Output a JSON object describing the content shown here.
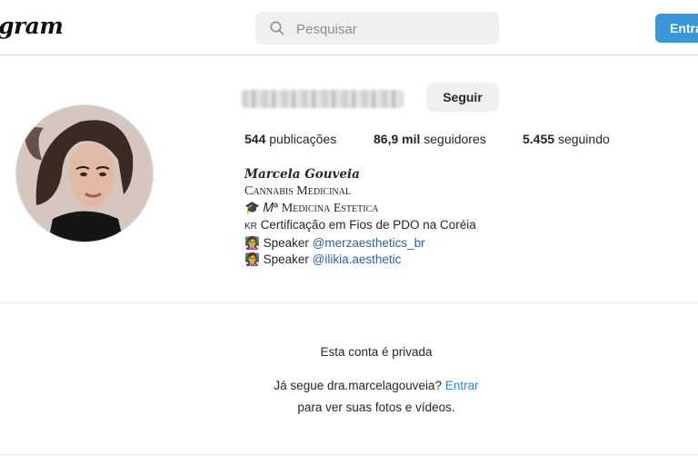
{
  "topbar": {
    "logo_text": "gram",
    "search_placeholder": "Pesquisar",
    "login_label": "Entrar"
  },
  "profile": {
    "follow_label": "Seguir",
    "stats": {
      "posts_count": "544",
      "posts_label": "publicações",
      "followers_count": "86,9 mil",
      "followers_label": "seguidores",
      "following_count": "5.455",
      "following_label": "seguindo"
    },
    "bio": {
      "name": "Marcela Gouveia",
      "line1_icon": "",
      "line1_text": "Cannabis Medicinal",
      "line2_icon": "🎓",
      "line2_prefix": "𝑀ª",
      "line2_text": "Medicina Estetica",
      "line3_prefix": "KR",
      "line3_text": "Certificação em Fios de PDO na Coréia",
      "line4_icon": "👩‍🏫",
      "line4_text": "Speaker",
      "line4_link": "@merzaesthetics_br",
      "line5_icon": "👩‍🏫",
      "line5_text": "Speaker",
      "line5_link": "@ilikia.aesthetic"
    }
  },
  "private_section": {
    "title": "Esta conta é privada",
    "question": "Já segue dra.marcelagouveia?",
    "login_link": "Entrar",
    "subtitle": "para ver suas fotos e vídeos."
  },
  "colors": {
    "accent": "#3897d8",
    "link": "#2a62a8",
    "divider": "#dbdbdb"
  },
  "icons": {
    "search": "search-icon",
    "avatar": "profile-avatar"
  }
}
